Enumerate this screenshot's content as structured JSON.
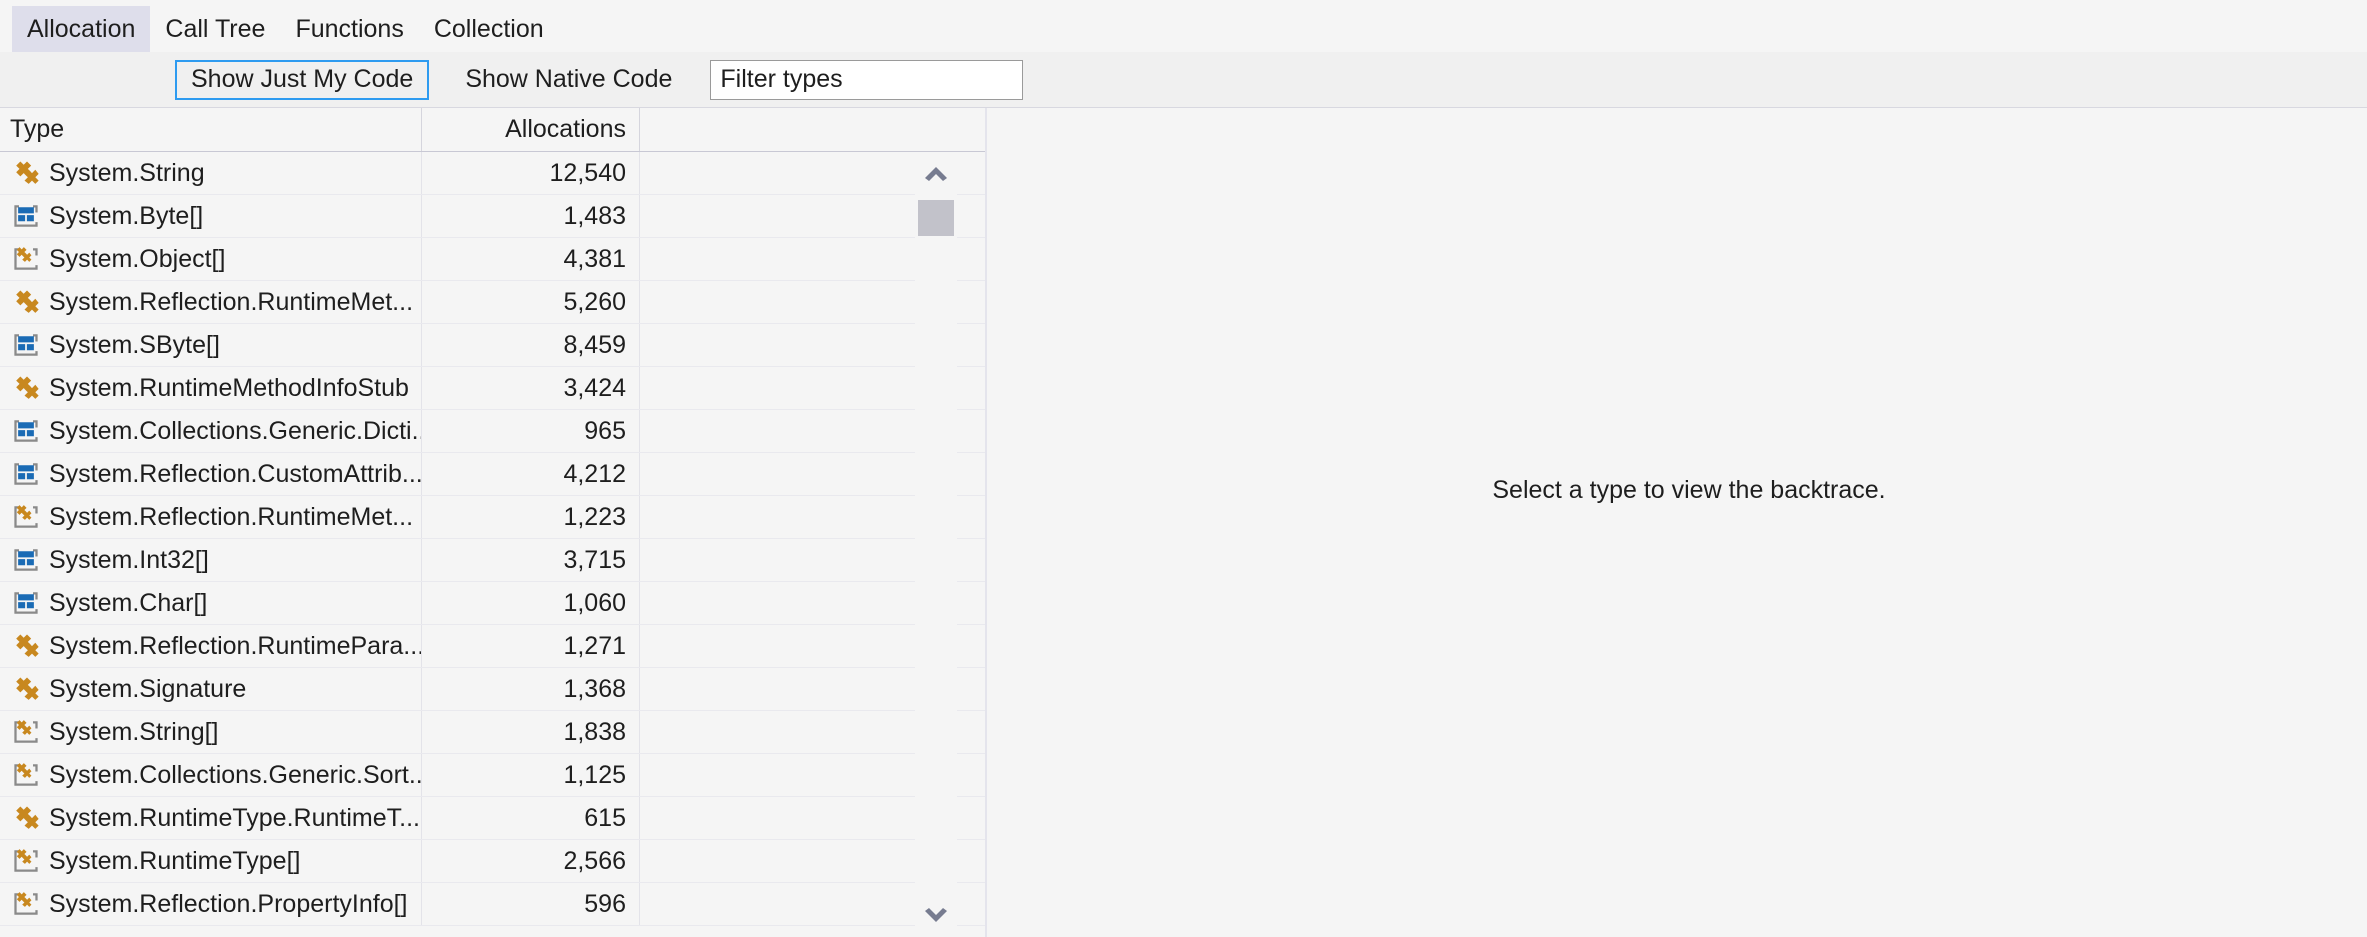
{
  "tabs": [
    {
      "label": "Allocation",
      "selected": true
    },
    {
      "label": "Call Tree",
      "selected": false
    },
    {
      "label": "Functions",
      "selected": false
    },
    {
      "label": "Collection",
      "selected": false
    }
  ],
  "toolbar": {
    "show_just_my_code_label": "Show Just My Code",
    "show_just_my_code_toggled": true,
    "show_native_code_label": "Show Native Code",
    "show_native_code_toggled": false,
    "filter_placeholder": "Filter types",
    "filter_value": ""
  },
  "grid": {
    "columns": [
      "Type",
      "Allocations"
    ],
    "rows": [
      {
        "icon": "class-icon",
        "type": "System.String",
        "allocations": "12,540"
      },
      {
        "icon": "struct-array-icon",
        "type": "System.Byte[]",
        "allocations": "1,483"
      },
      {
        "icon": "class-array-icon",
        "type": "System.Object[]",
        "allocations": "4,381"
      },
      {
        "icon": "class-icon",
        "type": "System.Reflection.RuntimeMet...",
        "allocations": "5,260"
      },
      {
        "icon": "struct-array-icon",
        "type": "System.SByte[]",
        "allocations": "8,459"
      },
      {
        "icon": "class-icon",
        "type": "System.RuntimeMethodInfoStub",
        "allocations": "3,424"
      },
      {
        "icon": "struct-array-icon",
        "type": "System.Collections.Generic.Dicti...",
        "allocations": "965"
      },
      {
        "icon": "struct-array-icon",
        "type": "System.Reflection.CustomAttrib...",
        "allocations": "4,212"
      },
      {
        "icon": "class-array-icon",
        "type": "System.Reflection.RuntimeMet...",
        "allocations": "1,223"
      },
      {
        "icon": "struct-array-icon",
        "type": "System.Int32[]",
        "allocations": "3,715"
      },
      {
        "icon": "struct-array-icon",
        "type": "System.Char[]",
        "allocations": "1,060"
      },
      {
        "icon": "class-icon",
        "type": "System.Reflection.RuntimePara...",
        "allocations": "1,271"
      },
      {
        "icon": "class-icon",
        "type": "System.Signature",
        "allocations": "1,368"
      },
      {
        "icon": "class-array-icon",
        "type": "System.String[]",
        "allocations": "1,838"
      },
      {
        "icon": "class-array-icon",
        "type": "System.Collections.Generic.Sort...",
        "allocations": "1,125"
      },
      {
        "icon": "class-icon",
        "type": "System.RuntimeType.RuntimeT...",
        "allocations": "615"
      },
      {
        "icon": "class-array-icon",
        "type": "System.RuntimeType[]",
        "allocations": "2,566"
      },
      {
        "icon": "class-array-icon",
        "type": "System.Reflection.PropertyInfo[]",
        "allocations": "596"
      }
    ]
  },
  "scrollbar": {
    "up_icon": "chevron-up-icon",
    "down_icon": "chevron-down-icon"
  },
  "detail": {
    "empty_message": "Select a type to view the backtrace."
  },
  "colors": {
    "accent": "#2e9bf0",
    "class_icon": "#c8881f",
    "struct_icon": "#1a6bb5",
    "bracket": "#8a8a8a",
    "tab_selected_bg": "#dedeeb",
    "surface": "#f5f5f5"
  }
}
